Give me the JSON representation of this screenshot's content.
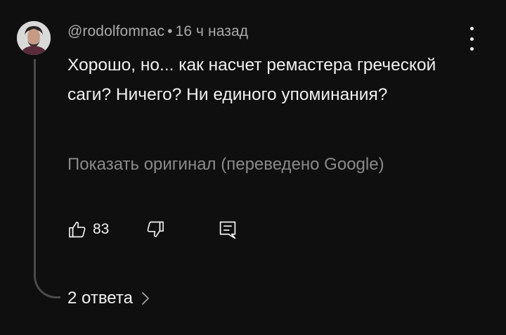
{
  "comment": {
    "author": "@rodolfomnac",
    "separator": "•",
    "time": "16 ч назад",
    "text": "Хорошо, но... как насчет ремастера греческой саги? Ничего? Ни единого упоминания?",
    "translate_link": "Показать оригинал (переведено Google)",
    "like_count": "83",
    "replies_label": "2 ответа"
  },
  "icons": {
    "menu": "more-vertical-icon",
    "like": "thumb-up-icon",
    "dislike": "thumb-down-icon",
    "reply": "reply-comment-icon",
    "expand": "chevron-right-icon"
  },
  "colors": {
    "background": "#0f0f0f",
    "primary_text": "#f1f1f1",
    "secondary_text": "#aaaaaa",
    "muted_link": "#8a8a8a",
    "thread_line": "#4a4a4a"
  }
}
